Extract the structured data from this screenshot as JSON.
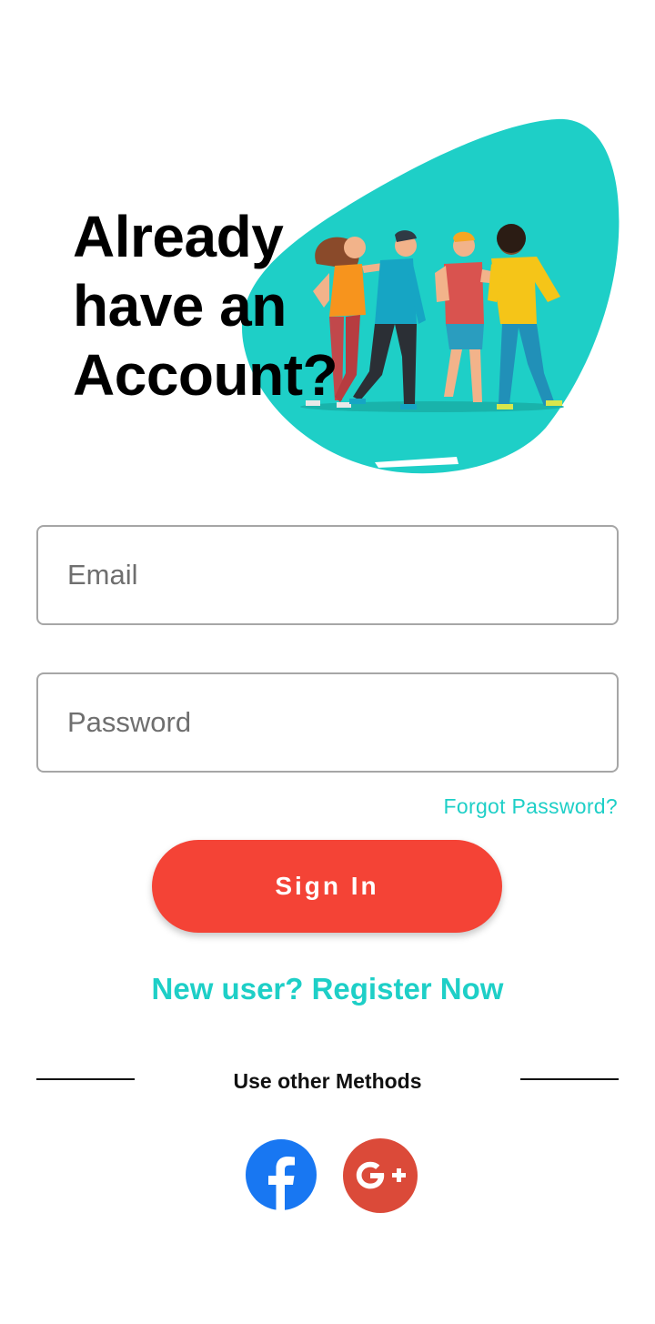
{
  "hero": {
    "heading": "Already\nhave an\nAccount?",
    "blob_color": "#1ecfc7"
  },
  "form": {
    "email_placeholder": "Email",
    "password_placeholder": "Password",
    "forgot_label": "Forgot Password?",
    "signin_label": "Sign In",
    "register_label": "New user? Register Now"
  },
  "social": {
    "divider_label": "Use other Methods",
    "providers": [
      {
        "name": "facebook",
        "icon": "facebook-icon",
        "color": "#1877f2"
      },
      {
        "name": "google-plus",
        "icon": "google-plus-icon",
        "color": "#db4a39"
      }
    ]
  },
  "colors": {
    "accent": "#1ecfc7",
    "primary_button": "#f44336"
  }
}
